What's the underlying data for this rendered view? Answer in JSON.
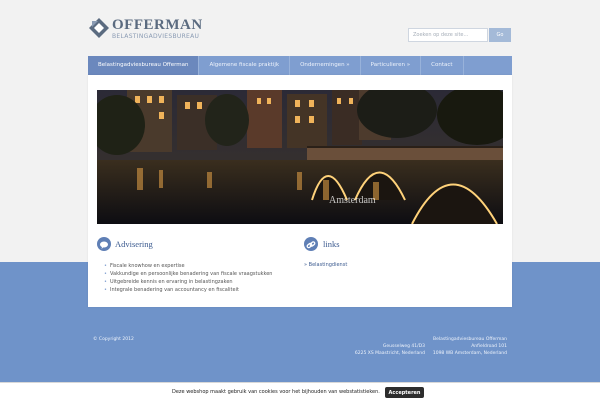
{
  "brand": {
    "name": "OFFERMAN",
    "tagline": "BELASTINGADVIESBUREAU"
  },
  "search": {
    "placeholder": "Zoeken op deze site...",
    "button_label": "Go"
  },
  "nav": {
    "items": [
      {
        "label": "Belastingadviesbureau Offerman",
        "active": true
      },
      {
        "label": "Algemene fiscale praktijk"
      },
      {
        "label": "Ondernemingen »"
      },
      {
        "label": "Particulieren »"
      },
      {
        "label": "Contact"
      }
    ]
  },
  "hero": {
    "caption": "Amsterdam"
  },
  "advisering": {
    "title": "Advisering",
    "items": [
      "Fiscale knowhow en expertise",
      "Vakkundige en persoonlijke benadering van fiscale vraagstukken",
      "Uitgebreide kennis en ervaring in belastingzaken",
      "Integrale benadering van accountancy en fiscaliteit"
    ]
  },
  "links": {
    "title": "links",
    "items": [
      "» Belastingdienst"
    ]
  },
  "footer": {
    "copyright": "© Copyright 2012",
    "address1": {
      "street": "Geusselweg 41/D3",
      "city": "6225 XS Maastricht, Nederland"
    },
    "address2": {
      "company": "Belastingadviesbureau Offerman",
      "street": "Anfieldroad 101",
      "city": "1098 WB Amsterdam, Nederland"
    }
  },
  "cookie": {
    "text": "Deze webshop maakt gebruik van cookies voor het bijhouden van webstatistieken.",
    "button_label": "Accepteren"
  },
  "colors": {
    "accent": "#7f9ed0",
    "band": "#6f93c9",
    "link": "#3b5a8f"
  }
}
